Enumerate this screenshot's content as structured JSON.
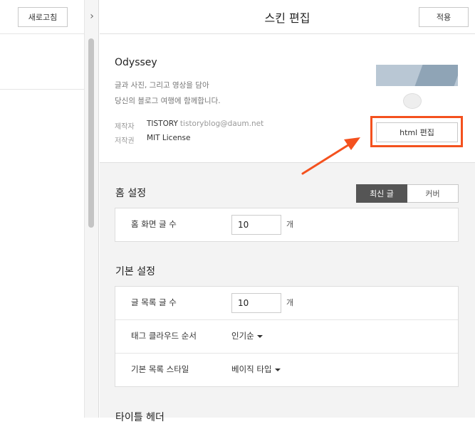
{
  "left": {
    "refresh_label": "새로고침",
    "collapse_glyph": "›"
  },
  "header": {
    "title": "스킨 편집",
    "apply_label": "적용"
  },
  "skin": {
    "name": "Odyssey",
    "desc_line1": "글과 사진, 그리고 영상을 담아",
    "desc_line2": "당신의 블로그 여행에 함께합니다.",
    "maker_key": "제작자",
    "maker_name": "TISTORY",
    "maker_email": "tistoryblog@daum.net",
    "license_key": "저작권",
    "license_val": "MIT License",
    "html_edit_label": "html 편집"
  },
  "home": {
    "title": "홈 설정",
    "tabs": [
      {
        "label": "최신 글"
      },
      {
        "label": "커버"
      }
    ],
    "post_count_label": "홈 화면 글 수",
    "post_count_value": "10",
    "unit": "개"
  },
  "basic": {
    "title": "기본 설정",
    "list_count_label": "글 목록 글 수",
    "list_count_value": "10",
    "unit": "개",
    "tag_cloud_label": "태그 클라우드 순서",
    "tag_cloud_value": "인기순",
    "list_style_label": "기본 목록 스타일",
    "list_style_value": "베이직 타입"
  },
  "next_section_title": "타이틀 헤더",
  "colors": {
    "highlight": "#f4511e",
    "active_tab": "#555555"
  }
}
